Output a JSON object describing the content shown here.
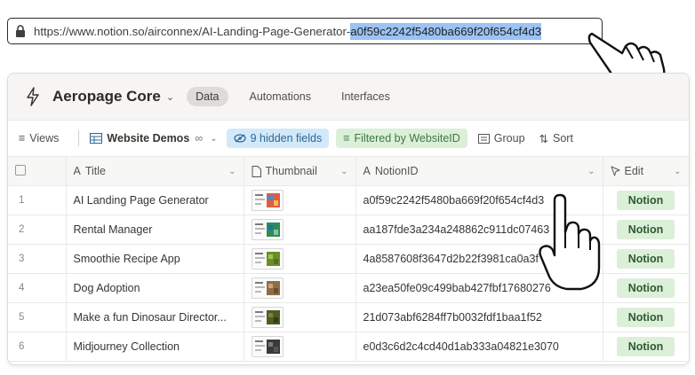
{
  "browser": {
    "url_prefix": "https://www.notion.so/airconnex/AI-Landing-Page-Generator-",
    "url_selected": "a0f59c2242f5480ba669f20f654cf4d3"
  },
  "app": {
    "name": "Aeropage Core",
    "tabs": [
      {
        "label": "Data"
      },
      {
        "label": "Automations"
      },
      {
        "label": "Interfaces"
      }
    ]
  },
  "viewbar": {
    "views_label": "Views",
    "view_name": "Website Demos",
    "hidden_fields": "9 hidden fields",
    "filter": "Filtered by WebsiteID",
    "group": "Group",
    "sort": "Sort"
  },
  "table": {
    "columns": [
      "Title",
      "Thumbnail",
      "NotionID",
      "Edit"
    ],
    "rows": [
      {
        "num": "1",
        "title": "AI Landing Page Generator",
        "id": "a0f59c2242f5480ba669f20f654cf4d3",
        "edit": "Notion"
      },
      {
        "num": "2",
        "title": "Rental Manager",
        "id": "aa187fde3a234a248862c911dc07463",
        "edit": "Notion"
      },
      {
        "num": "3",
        "title": "Smoothie Recipe App",
        "id": "4a8587608f3647d2b22f3981ca0a3f",
        "edit": "Notion"
      },
      {
        "num": "4",
        "title": "Dog Adoption",
        "id": "a23ea50fe09c499bab427fbf17680276",
        "edit": "Notion"
      },
      {
        "num": "5",
        "title": "Make a fun Dinosaur Director...",
        "id": "21d073abf6284ff7b0032fdf1baa1f52",
        "edit": "Notion"
      },
      {
        "num": "6",
        "title": "Midjourney Collection",
        "id": "e0d3c6d2c4cd40d1ab333a04821e3070",
        "edit": "Notion"
      }
    ]
  },
  "colors": {
    "selection": "#9bc3f3",
    "chip_blue": "#d3e8f8",
    "chip_green": "#dcefd9"
  },
  "icons": [
    "lock-icon",
    "lightning-icon",
    "hamburger-icon",
    "table-icon",
    "eye-off-icon",
    "filter-icon",
    "group-icon",
    "sort-icon",
    "text-icon",
    "file-icon",
    "cursor-icon",
    "pointing-hand-icon"
  ]
}
